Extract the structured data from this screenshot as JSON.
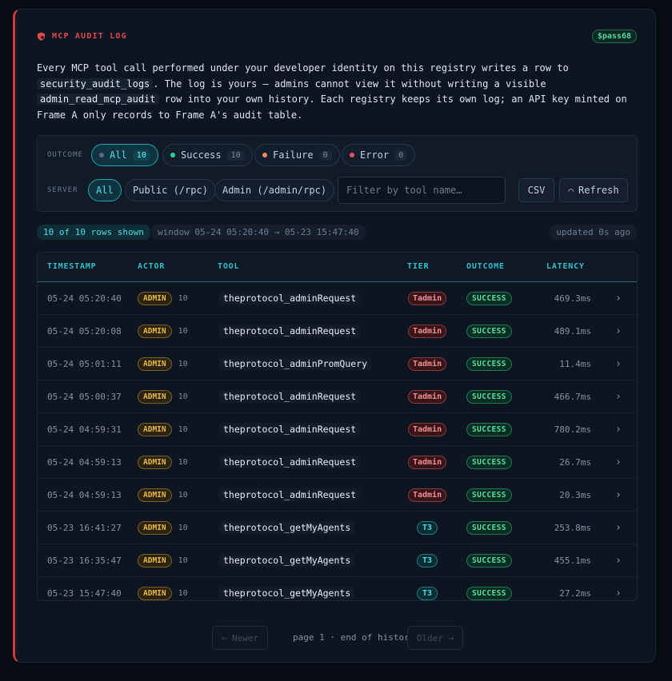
{
  "header": {
    "title": "MCP AUDIT LOG",
    "badge": "$pass68",
    "accent_color": "#e0494a"
  },
  "description": {
    "p1": "Every MCP tool call performed under your developer identity on this registry writes a row to ",
    "code1": "security_audit_logs",
    "p2": ". The log is yours — admins cannot view it without writing a visible ",
    "code2": "admin_read_mcp_audit",
    "p3": " row into your own history. Each registry keeps its own log; an API key minted on Frame A only records to Frame A's audit table."
  },
  "filters": {
    "outcome_label": "OUTCOME",
    "outcome": [
      {
        "label": "All",
        "count": "10",
        "color": "#5d6b7c",
        "active": true
      },
      {
        "label": "Success",
        "count": "10",
        "color": "#2fd28a",
        "active": false
      },
      {
        "label": "Failure",
        "count": "0",
        "color": "#f08a5a",
        "active": false
      },
      {
        "label": "Error",
        "count": "0",
        "color": "#f05252",
        "active": false
      }
    ],
    "server_label": "SERVER",
    "server": [
      {
        "label": "All",
        "active": true
      },
      {
        "label": "Public (/rpc)",
        "active": false
      },
      {
        "label": "Admin (/admin/rpc)",
        "active": false
      }
    ],
    "search_placeholder": "Filter by tool name…",
    "search_value": "",
    "csv_label": "CSV",
    "refresh_label": "Refresh"
  },
  "summary": {
    "rows_shown": "10 of 10 rows shown",
    "window": "window 05-24 05:20:40 → 05-23 15:47:40",
    "updated": "updated 0s ago"
  },
  "table": {
    "columns": [
      "TIMESTAMP",
      "ACTOR",
      "TOOL",
      "TIER",
      "OUTCOME",
      "LATENCY"
    ],
    "rows": [
      {
        "ts": "05-24 05:20:40",
        "actor": "ADMIN",
        "actor_n": "10",
        "tool": "theprotocol_adminRequest",
        "tier": "Tadmin",
        "outcome": "SUCCESS",
        "latency": "469.3ms"
      },
      {
        "ts": "05-24 05:20:08",
        "actor": "ADMIN",
        "actor_n": "10",
        "tool": "theprotocol_adminRequest",
        "tier": "Tadmin",
        "outcome": "SUCCESS",
        "latency": "489.1ms"
      },
      {
        "ts": "05-24 05:01:11",
        "actor": "ADMIN",
        "actor_n": "10",
        "tool": "theprotocol_adminPromQuery",
        "tier": "Tadmin",
        "outcome": "SUCCESS",
        "latency": "11.4ms"
      },
      {
        "ts": "05-24 05:00:37",
        "actor": "ADMIN",
        "actor_n": "10",
        "tool": "theprotocol_adminRequest",
        "tier": "Tadmin",
        "outcome": "SUCCESS",
        "latency": "466.7ms"
      },
      {
        "ts": "05-24 04:59:31",
        "actor": "ADMIN",
        "actor_n": "10",
        "tool": "theprotocol_adminRequest",
        "tier": "Tadmin",
        "outcome": "SUCCESS",
        "latency": "780.2ms"
      },
      {
        "ts": "05-24 04:59:13",
        "actor": "ADMIN",
        "actor_n": "10",
        "tool": "theprotocol_adminRequest",
        "tier": "Tadmin",
        "outcome": "SUCCESS",
        "latency": "26.7ms"
      },
      {
        "ts": "05-24 04:59:13",
        "actor": "ADMIN",
        "actor_n": "10",
        "tool": "theprotocol_adminRequest",
        "tier": "Tadmin",
        "outcome": "SUCCESS",
        "latency": "20.3ms"
      },
      {
        "ts": "05-23 16:41:27",
        "actor": "ADMIN",
        "actor_n": "10",
        "tool": "theprotocol_getMyAgents",
        "tier": "T3",
        "outcome": "SUCCESS",
        "latency": "253.8ms"
      },
      {
        "ts": "05-23 16:35:47",
        "actor": "ADMIN",
        "actor_n": "10",
        "tool": "theprotocol_getMyAgents",
        "tier": "T3",
        "outcome": "SUCCESS",
        "latency": "455.1ms"
      },
      {
        "ts": "05-23 15:47:40",
        "actor": "ADMIN",
        "actor_n": "10",
        "tool": "theprotocol_getMyAgents",
        "tier": "T3",
        "outcome": "SUCCESS",
        "latency": "27.2ms"
      }
    ]
  },
  "pager": {
    "newer": "← Newer",
    "status": "page 1 · end of history",
    "older": "Older →"
  }
}
